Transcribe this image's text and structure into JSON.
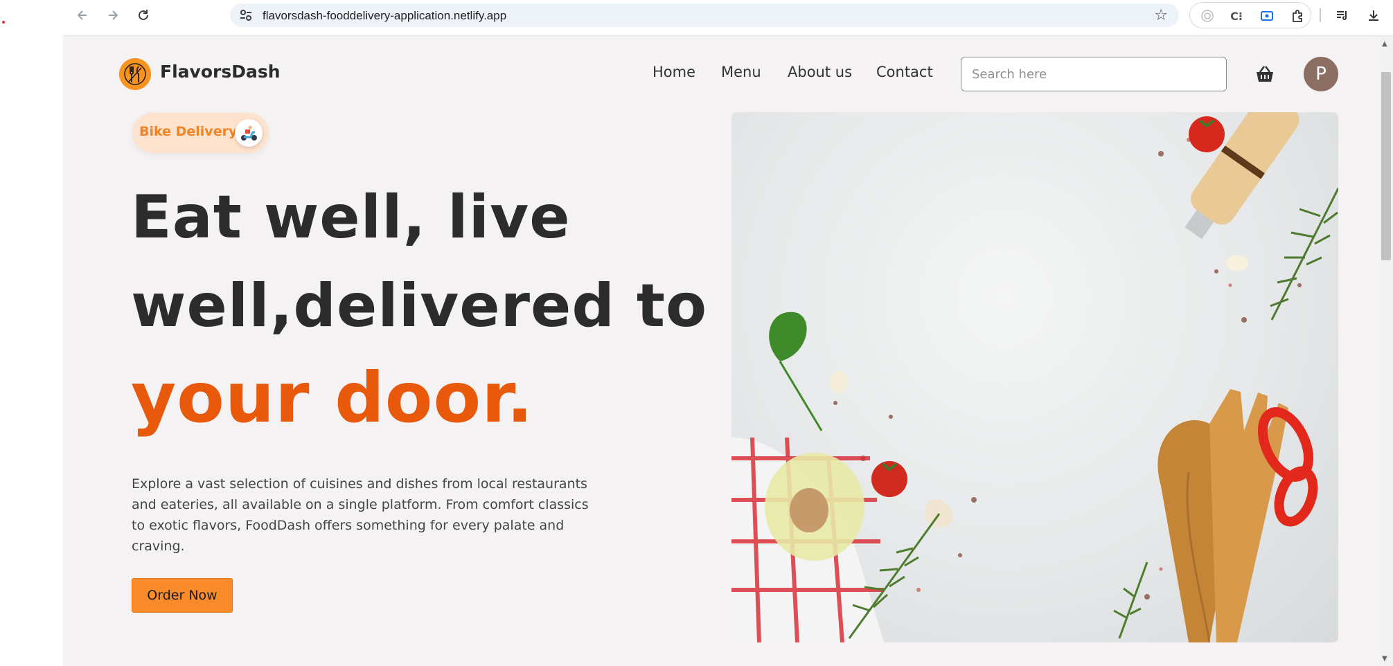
{
  "browser": {
    "url": "flavorsdash-fooddelivery-application.netlify.app",
    "profile_initial": "P",
    "icons": [
      "back-arrow-icon",
      "forward-arrow-icon",
      "reload-icon",
      "site-info-icon",
      "bookmark-star-icon",
      "extension-radar-icon",
      "extension-c-icon",
      "extension-screen-icon",
      "extensions-puzzle-icon",
      "media-controls-icon",
      "download-icon",
      "menu-kebab-icon"
    ]
  },
  "header": {
    "brand": "FlavorsDash",
    "nav": [
      "Home",
      "Menu",
      "About us",
      "Contact"
    ],
    "search_placeholder": "Search here",
    "avatar_initial": "P"
  },
  "hero": {
    "badge": "Bike Delivery",
    "headline_line1": "Eat well, live",
    "headline_line2": "well,delivered to",
    "headline_accent": "your door.",
    "description": "Explore a vast selection of cuisines and dishes from local restaurants and eateries, all available on a single platform. From comfort classics to exotic flavors, FoodDash offers something for every palate and craving.",
    "cta": "Order Now"
  },
  "colors": {
    "accent": "#e8590c",
    "button": "#f98b2a",
    "badge_bg": "#fde2cd",
    "badge_text": "#f08424",
    "page_bg": "#f4f2f3",
    "avatar": "#8d6e63"
  }
}
